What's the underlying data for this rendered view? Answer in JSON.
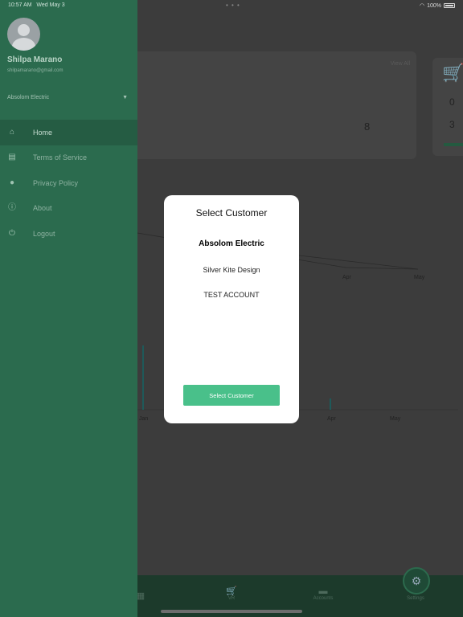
{
  "status_bar": {
    "time": "10:57 AM",
    "date": "Wed May 3",
    "battery": "100%"
  },
  "background": {
    "card_view_all": "View All",
    "card_value": "8",
    "side_values": [
      "0",
      "3"
    ],
    "chart1_x_labels": [
      "Apr",
      "May"
    ],
    "chart2_x_labels": [
      "Jan",
      "Apr",
      "May"
    ],
    "tabs": [
      "",
      "VR",
      "Accounts",
      "Settings"
    ]
  },
  "drawer": {
    "user_name": "Shilpa Marano",
    "user_email": "shilpamarano@gmail.com",
    "company": "Absolom Electric",
    "menu": [
      {
        "label": "Home",
        "icon": "home-icon",
        "active": true
      },
      {
        "label": "Terms of Service",
        "icon": "clipboard-icon",
        "active": false
      },
      {
        "label": "Privacy Policy",
        "icon": "user-lock-icon",
        "active": false
      },
      {
        "label": "About",
        "icon": "info-icon",
        "active": false
      },
      {
        "label": "Logout",
        "icon": "power-icon",
        "active": false
      }
    ]
  },
  "modal": {
    "title": "Select Customer",
    "options": [
      "Absolom Electric",
      "Silver Kite Design",
      "TEST ACCOUNT"
    ],
    "selected_index": 0,
    "button_label": "Select Customer"
  },
  "colors": {
    "drawer": "#2b6b4e",
    "accent": "#49c08a",
    "overlay": "#3a3a3a"
  }
}
